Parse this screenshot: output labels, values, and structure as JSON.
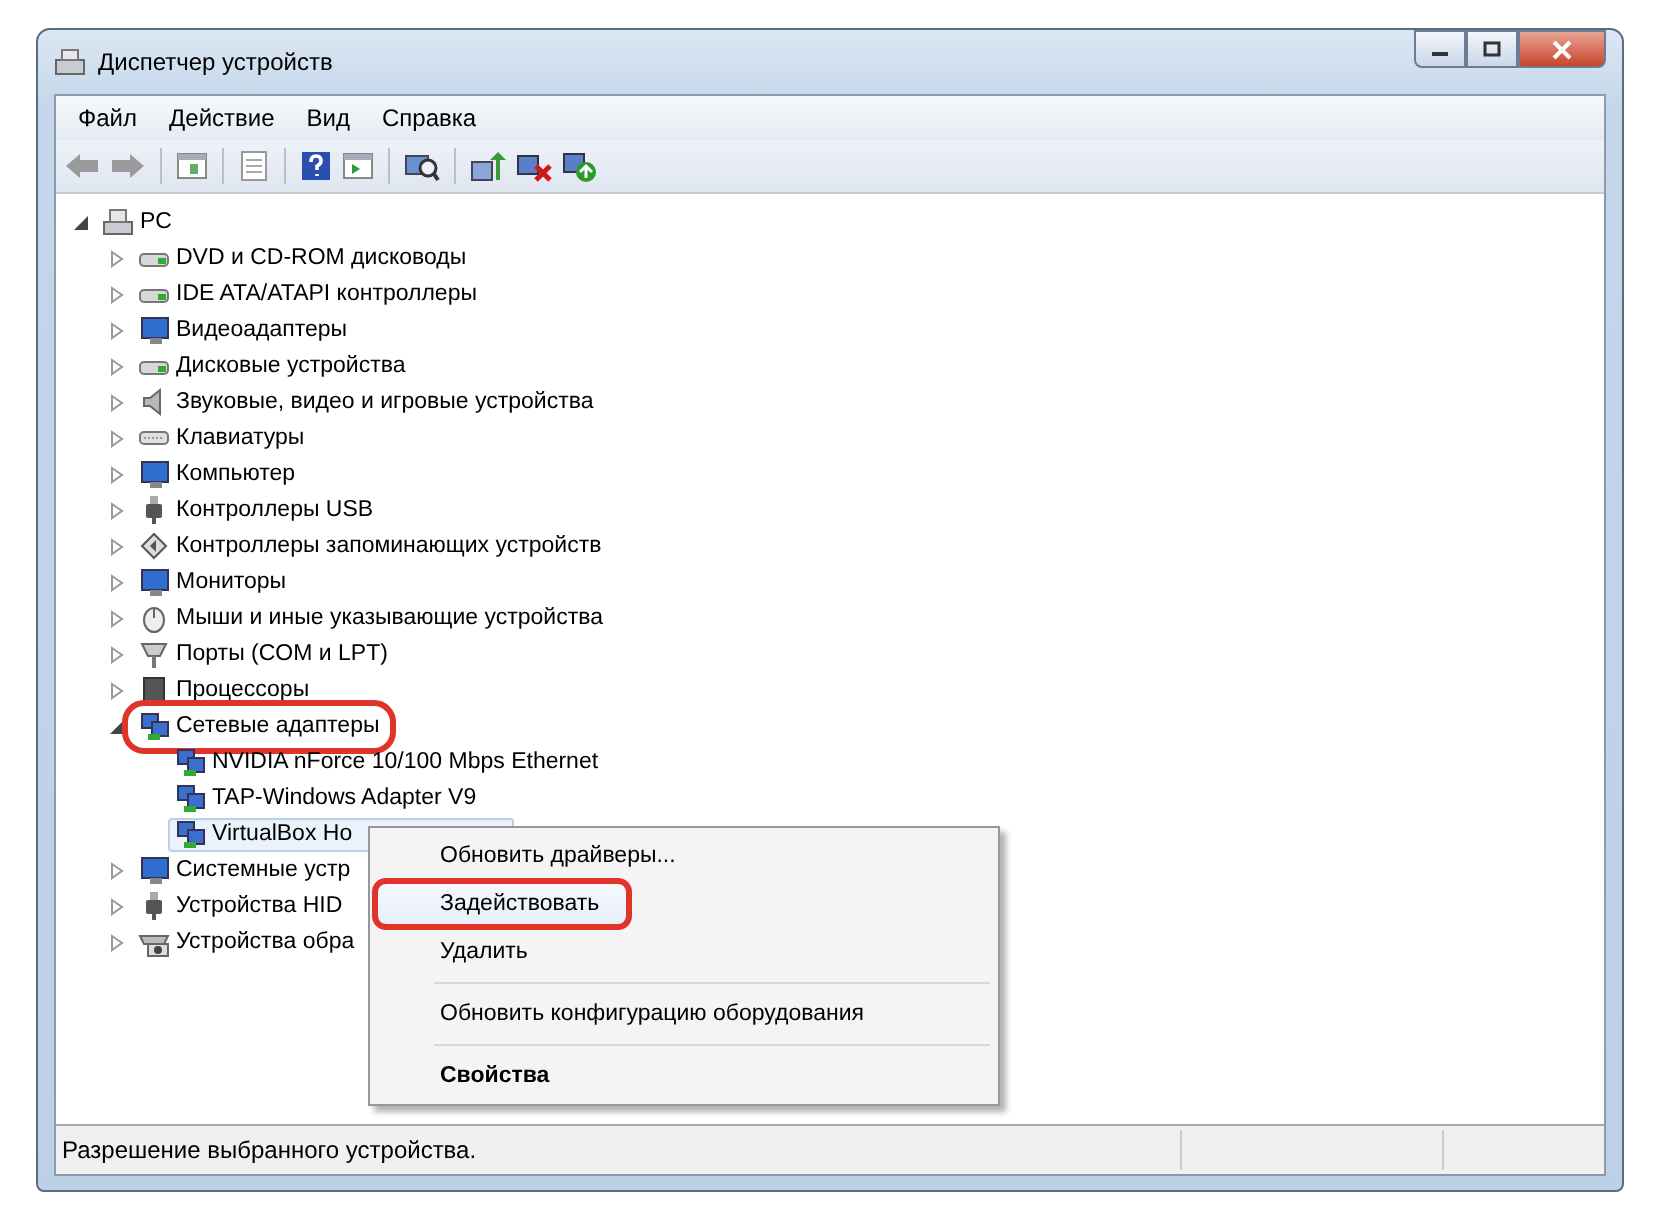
{
  "window": {
    "title": "Диспетчер устройств"
  },
  "menu_bar": [
    "Файл",
    "Действие",
    "Вид",
    "Справка"
  ],
  "tree": [
    {
      "label": "PC",
      "kind": "computer",
      "expanded": true,
      "selected": false,
      "highlighted": false,
      "children": [
        {
          "label": "DVD и CD-ROM дисководы",
          "kind": "drive",
          "expanded": false,
          "selected": false,
          "highlighted": false
        },
        {
          "label": "IDE ATA/ATAPI контроллеры",
          "kind": "drive",
          "expanded": false,
          "selected": false,
          "highlighted": false
        },
        {
          "label": "Видеоадаптеры",
          "kind": "monitor",
          "expanded": false,
          "selected": false,
          "highlighted": false
        },
        {
          "label": "Дисковые устройства",
          "kind": "drive",
          "expanded": false,
          "selected": false,
          "highlighted": false
        },
        {
          "label": "Звуковые, видео и игровые устройства",
          "kind": "speaker",
          "expanded": false,
          "selected": false,
          "highlighted": false
        },
        {
          "label": "Клавиатуры",
          "kind": "keyboard",
          "expanded": false,
          "selected": false,
          "highlighted": false
        },
        {
          "label": "Компьютер",
          "kind": "monitor",
          "expanded": false,
          "selected": false,
          "highlighted": false
        },
        {
          "label": "Контроллеры USB",
          "kind": "usb",
          "expanded": false,
          "selected": false,
          "highlighted": false
        },
        {
          "label": "Контроллеры запоминающих устройств",
          "kind": "storage",
          "expanded": false,
          "selected": false,
          "highlighted": false
        },
        {
          "label": "Мониторы",
          "kind": "monitor",
          "expanded": false,
          "selected": false,
          "highlighted": false
        },
        {
          "label": "Мыши и иные указывающие устройства",
          "kind": "mouse",
          "expanded": false,
          "selected": false,
          "highlighted": false
        },
        {
          "label": "Порты (COM и LPT)",
          "kind": "port",
          "expanded": false,
          "selected": false,
          "highlighted": false
        },
        {
          "label": "Процессоры",
          "kind": "chip",
          "expanded": false,
          "selected": false,
          "highlighted": false
        },
        {
          "label": "Сетевые адаптеры",
          "kind": "network",
          "expanded": true,
          "selected": false,
          "highlighted": true,
          "children": [
            {
              "label": "NVIDIA nForce 10/100 Mbps Ethernet",
              "kind": "network",
              "selected": false,
              "highlighted": false
            },
            {
              "label": "TAP-Windows Adapter V9",
              "kind": "network",
              "selected": false,
              "highlighted": false
            },
            {
              "label": "VirtualBox Ho",
              "kind": "network",
              "selected": true,
              "highlighted": false
            }
          ]
        },
        {
          "label": "Системные устр",
          "kind": "monitor",
          "expanded": false,
          "selected": false,
          "highlighted": false
        },
        {
          "label": "Устройства HID",
          "kind": "usb",
          "expanded": false,
          "selected": false,
          "highlighted": false
        },
        {
          "label": "Устройства обра",
          "kind": "camera",
          "expanded": false,
          "selected": false,
          "highlighted": false
        }
      ]
    }
  ],
  "context_menu": [
    {
      "label": "Обновить драйверы...",
      "selected": false,
      "highlighted": false,
      "bold": false
    },
    {
      "label": "Задействовать",
      "selected": true,
      "highlighted": true,
      "bold": false
    },
    {
      "label": "Удалить",
      "selected": false,
      "highlighted": false,
      "bold": false,
      "separator_after": true
    },
    {
      "label": "Обновить конфигурацию оборудования",
      "selected": false,
      "highlighted": false,
      "bold": false,
      "separator_after": true
    },
    {
      "label": "Свойства",
      "selected": false,
      "highlighted": false,
      "bold": true
    }
  ],
  "status_bar": "Разрешение выбранного устройства."
}
